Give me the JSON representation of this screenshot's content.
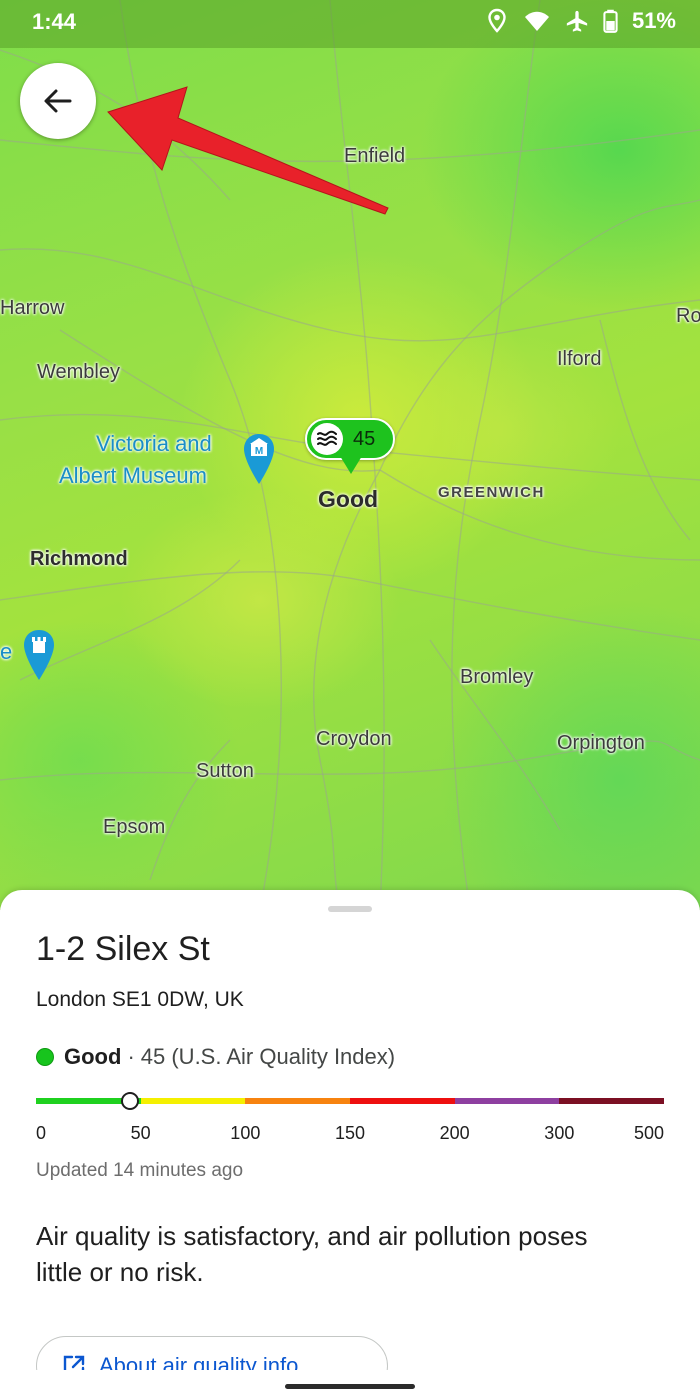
{
  "status_bar": {
    "time": "1:44",
    "battery": "51%",
    "icons": [
      "location-icon",
      "wifi-icon",
      "airplane-icon",
      "battery-icon"
    ]
  },
  "map": {
    "places": {
      "enfield": "Enfield",
      "harrow": "Harrow",
      "ro": "Ro",
      "wembley": "Wembley",
      "ilford": "Ilford",
      "victoria_museum_line1": "Victoria and",
      "victoria_museum_line2": "Albert Museum",
      "greenwich": "GREENWICH",
      "richmond": "Richmond",
      "e": "e",
      "bromley": "Bromley",
      "croydon": "Croydon",
      "orpington": "Orpington",
      "sutton": "Sutton",
      "epsom": "Epsom"
    },
    "aqi_marker": {
      "value": "45",
      "label": "Good",
      "color": "#1ec21e"
    }
  },
  "sheet": {
    "title": "1-2 Silex St",
    "address": "London SE1 0DW, UK",
    "aqi_status": "Good",
    "aqi_separator": "·",
    "aqi_detail": "45 (U.S. Air Quality Index)",
    "aqi_value": 45,
    "scale": {
      "ticks": [
        "0",
        "50",
        "100",
        "150",
        "200",
        "300",
        "500"
      ],
      "colors": [
        "#1fd11f",
        "#f5f000",
        "#f7830f",
        "#ee0f0f",
        "#8e3fa0",
        "#7b0f23"
      ]
    },
    "updated": "Updated 14 minutes ago",
    "description": "Air quality is satisfactory, and air pollution poses little or no risk.",
    "info_button_label": "About air quality info"
  },
  "colors": {
    "accent_blue": "#0b57d0",
    "good_green": "#17c41d",
    "annotation_red": "#e8212a"
  }
}
